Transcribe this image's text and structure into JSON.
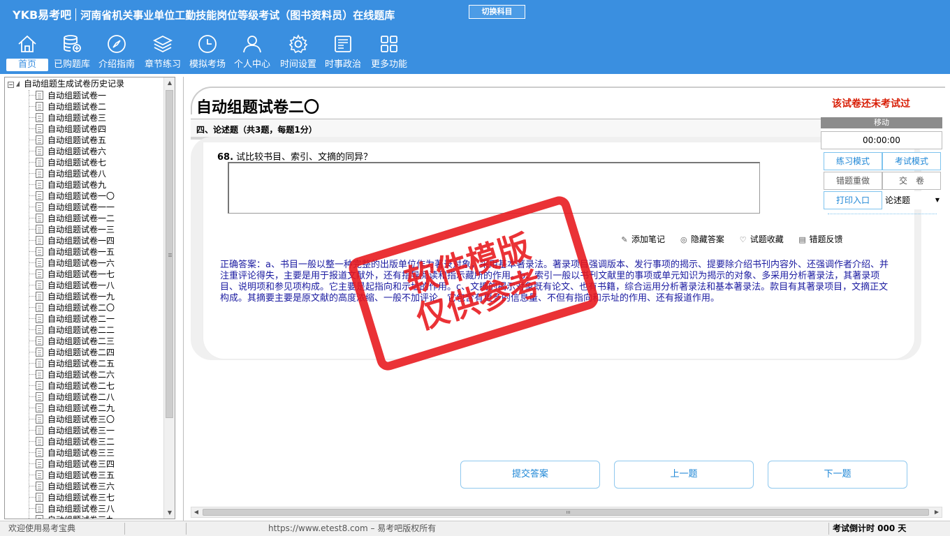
{
  "header": {
    "logo": "YKB易考吧",
    "app_title": "河南省机关事业单位工勤技能岗位等级考试（图书资料员）在线题库",
    "switch_subject": "切换科目"
  },
  "nav": {
    "items": [
      {
        "label": "首页",
        "icon": "home-icon"
      },
      {
        "label": "已购题库",
        "icon": "database-icon"
      },
      {
        "label": "介绍指南",
        "icon": "compass-icon"
      },
      {
        "label": "章节练习",
        "icon": "layers-icon"
      },
      {
        "label": "模拟考场",
        "icon": "clock-icon"
      },
      {
        "label": "个人中心",
        "icon": "user-icon"
      },
      {
        "label": "时间设置",
        "icon": "gear-icon"
      },
      {
        "label": "时事政治",
        "icon": "news-icon"
      },
      {
        "label": "更多功能",
        "icon": "grid-icon"
      }
    ]
  },
  "tree": {
    "root": "自动组题生成试卷历史记录",
    "items": [
      "自动组题试卷一",
      "自动组题试卷二",
      "自动组题试卷三",
      "自动组题试卷四",
      "自动组题试卷五",
      "自动组题试卷六",
      "自动组题试卷七",
      "自动组题试卷八",
      "自动组题试卷九",
      "自动组题试卷一〇",
      "自动组题试卷一一",
      "自动组题试卷一二",
      "自动组题试卷一三",
      "自动组题试卷一四",
      "自动组题试卷一五",
      "自动组题试卷一六",
      "自动组题试卷一七",
      "自动组题试卷一八",
      "自动组题试卷一九",
      "自动组题试卷二〇",
      "自动组题试卷二一",
      "自动组题试卷二二",
      "自动组题试卷二三",
      "自动组题试卷二四",
      "自动组题试卷二五",
      "自动组题试卷二六",
      "自动组题试卷二七",
      "自动组题试卷二八",
      "自动组题试卷二九",
      "自动组题试卷三〇",
      "自动组题试卷三一",
      "自动组题试卷三二",
      "自动组题试卷三三",
      "自动组题试卷三四",
      "自动组题试卷三五",
      "自动组题试卷三六",
      "自动组题试卷三七",
      "自动组题试卷三八",
      "自动组题试卷三九"
    ]
  },
  "main": {
    "paper_title": "自动组题试卷二〇",
    "status": "该试卷还未考试过",
    "section_title": "四、论述题（共3题，每题1分）",
    "question_no": "68.",
    "question_text": "试比较书目、索引、文摘的同异？",
    "actions": [
      {
        "label": "添加笔记",
        "icon": "pencil-icon",
        "glyph": "✎"
      },
      {
        "label": "隐藏答案",
        "icon": "eye-icon",
        "glyph": "◎"
      },
      {
        "label": "试题收藏",
        "icon": "heart-icon",
        "glyph": "♡"
      },
      {
        "label": "错题反馈",
        "icon": "feedback-icon",
        "glyph": "▤"
      }
    ],
    "answer": "正确答案：a、书目一般以整一种完整的出版单位作为著录对象，采用基本著录法。著录项目强调版本、发行事项的揭示、提要除介绍书刊内容外、还强调作者介绍、并注重评论得失，主要是用于报道文献外，还有指导阅读和指示藏所的作用。b、索引一般以书刊文献里的事项或单元知识为揭示的对象、多采用分析著录法，其著录项目、说明项和参见项构成。它主要是起指向和示址的作用。c、文摘的揭示对象既有论文、也有书籍，综合运用分析著录法和基本著录法。款目有其著录项目，文摘正文构成。其摘要主要是原文献的高度浓缩、一般不加评论。它包含有更多的信息量、不但有指向和示址的作用、还有报道作用。",
    "buttons": {
      "submit": "提交答案",
      "prev": "上一题",
      "next": "下一题"
    }
  },
  "side_panel": {
    "move": "移动",
    "timer": "00:00:00",
    "practice_mode": "练习模式",
    "exam_mode": "考试模式",
    "redo_wrong": "错题重做",
    "submit_paper": "交　卷",
    "print": "打印入口",
    "question_type": "论述题"
  },
  "watermark": {
    "line1": "软件模版",
    "line2": "仅供参考"
  },
  "statusbar": {
    "welcome": "欢迎使用易考宝典",
    "copyright": "https://www.etest8.com – 易考吧版权所有",
    "countdown": "考试倒计时 000 天"
  },
  "colors": {
    "header_bg": "#3a8fe0",
    "accent": "#1d86d6",
    "status_red": "#d81e06",
    "answer_blue": "#1a1aa0"
  }
}
